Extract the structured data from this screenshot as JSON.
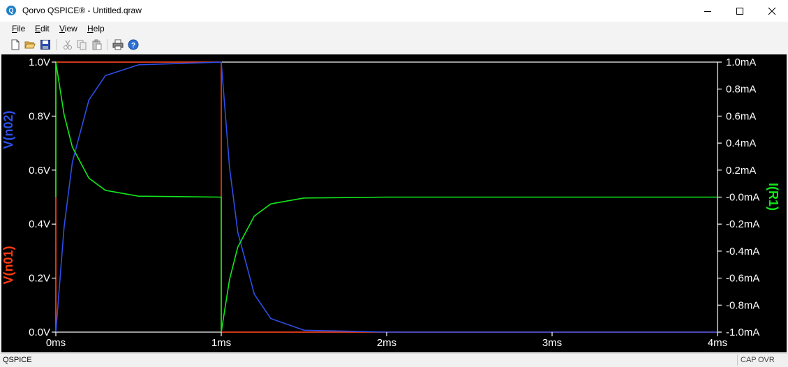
{
  "window": {
    "title": "Qorvo QSPICE® - Untitled.qraw",
    "app_icon_letter": "Q"
  },
  "menu": [
    "File",
    "Edit",
    "View",
    "Help"
  ],
  "toolbar": {
    "icons": [
      "new-file-icon",
      "open-folder-icon",
      "save-icon",
      "cut-icon",
      "copy-icon",
      "paste-icon",
      "print-icon",
      "help-icon"
    ]
  },
  "plot": {
    "background": "#000000",
    "axis_color": "#ffffff",
    "grid": false,
    "left_axis_ticks": [
      "1.0V",
      "0.8V",
      "0.6V",
      "0.4V",
      "0.2V",
      "0.0V"
    ],
    "right_axis_ticks": [
      "1.0mA",
      "0.8mA",
      "0.6mA",
      "0.4mA",
      "0.2mA",
      "-0.0mA",
      "-0.2mA",
      "-0.4mA",
      "-0.6mA",
      "-0.8mA",
      "-1.0mA"
    ],
    "x_ticks": [
      "0ms",
      "1ms",
      "2ms",
      "3ms",
      "4ms"
    ],
    "trace_labels": {
      "vn02": "V(n02)",
      "vn01": "V(n01)",
      "ir1": "I(R1)"
    },
    "colors": {
      "vn02": "#2d4ee6",
      "vn01": "#ff3b10",
      "ir1": "#12e61a"
    }
  },
  "chart_data": {
    "type": "line",
    "x_unit": "ms",
    "xlim": [
      0,
      4
    ],
    "ylim_left": [
      0,
      1.0
    ],
    "ylim_right": [
      -1.0,
      1.0
    ],
    "series": [
      {
        "name": "V(n02)",
        "axis": "left",
        "x": [
          0,
          0.05,
          0.1,
          0.2,
          0.3,
          0.5,
          1.0,
          1.05,
          1.1,
          1.2,
          1.3,
          1.5,
          2.0,
          4.0
        ],
        "y": [
          0,
          0.39,
          0.63,
          0.86,
          0.95,
          0.99,
          1.0,
          0.61,
          0.37,
          0.14,
          0.05,
          0.007,
          0,
          0
        ]
      },
      {
        "name": "V(n01)",
        "axis": "left",
        "x": [
          0,
          0,
          1.0,
          1.0,
          4.0
        ],
        "y": [
          0,
          1.0,
          1.0,
          0,
          0
        ]
      },
      {
        "name": "I(R1)",
        "axis": "right",
        "x": [
          0,
          0,
          0.05,
          0.1,
          0.2,
          0.3,
          0.5,
          1.0,
          1.0,
          1.05,
          1.1,
          1.2,
          1.3,
          1.5,
          2.0,
          4.0
        ],
        "y": [
          0,
          1.0,
          0.61,
          0.37,
          0.14,
          0.05,
          0.007,
          0,
          -1.0,
          -0.61,
          -0.37,
          -0.14,
          -0.05,
          -0.007,
          0,
          0
        ]
      }
    ]
  },
  "status": {
    "left": "QSPICE",
    "indicators": [
      "CAP",
      "OVR"
    ]
  }
}
